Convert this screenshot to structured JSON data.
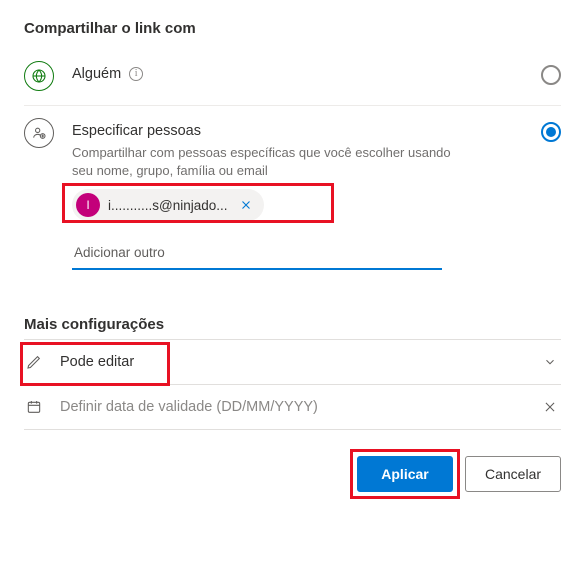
{
  "share": {
    "title": "Compartilhar o link com",
    "anyone": {
      "label": "Alguém"
    },
    "specific": {
      "label": "Especificar pessoas",
      "desc": "Compartilhar com pessoas específicas que você escolher usando seu nome, grupo, família ou email",
      "chip": {
        "initial": "I",
        "text": "i...........s@ninjado..."
      },
      "add_placeholder": "Adicionar outro"
    }
  },
  "more": {
    "title": "Mais configurações",
    "permission_label": "Pode editar",
    "expiry_placeholder": "Definir data de validade (DD/MM/YYYY)"
  },
  "footer": {
    "apply": "Aplicar",
    "cancel": "Cancelar"
  }
}
